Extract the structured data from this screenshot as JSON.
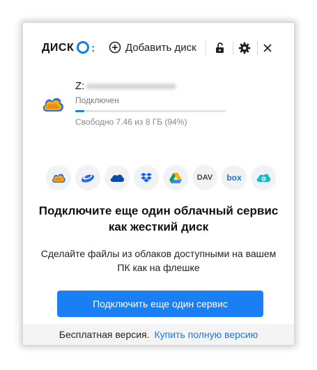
{
  "header": {
    "logo_text": "ДИСК",
    "logo_suffix": ":",
    "add_disk_label": "Добавить диск",
    "icons": [
      "plus-circle-icon",
      "unlock-icon",
      "gear-icon",
      "close-icon"
    ]
  },
  "disk": {
    "letter": "Z:",
    "status": "Подключен",
    "usage_fraction": 0.06,
    "free_text": "Свободно 7.46 из 8 ГБ (94%)"
  },
  "services": [
    {
      "name": "mail-cloud",
      "icon": "mail-cloud-icon"
    },
    {
      "name": "yandex-disk",
      "icon": "yandex-disk-icon"
    },
    {
      "name": "onedrive",
      "icon": "onedrive-icon"
    },
    {
      "name": "dropbox",
      "icon": "dropbox-icon"
    },
    {
      "name": "google-drive",
      "icon": "google-drive-icon"
    },
    {
      "name": "webdav",
      "icon": "webdav-icon",
      "label": "DAV"
    },
    {
      "name": "box",
      "icon": "box-icon",
      "label": "box"
    },
    {
      "name": "pcloud",
      "icon": "pcloud-icon"
    }
  ],
  "promo": {
    "title": "Подключите еще один облачный сервис как жесткий диск",
    "text": "Сделайте файлы из облаков доступными на вашем ПК как на флешке",
    "button": "Подключить еще один сервис"
  },
  "footer": {
    "free_version": "Бесплатная версия.",
    "buy_link": "Купить полную версию"
  },
  "colors": {
    "accent": "#1a7ff5",
    "link": "#1a73e8",
    "logo_blue": "#0f7eea"
  }
}
